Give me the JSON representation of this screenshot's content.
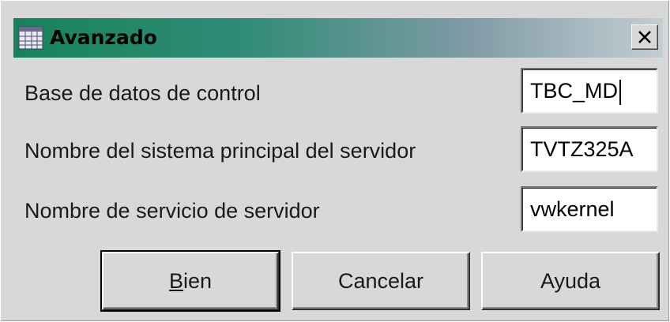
{
  "window": {
    "title": "Avanzado",
    "icon": "table-grid-icon",
    "close_symbol": "close-icon"
  },
  "fields": [
    {
      "label": "Base de datos de control",
      "value": "TBC_MD"
    },
    {
      "label": "Nombre del sistema principal del servidor",
      "value": "TVTZ325A"
    },
    {
      "label": "Nombre de servicio de servidor",
      "value": "vwkernel"
    }
  ],
  "buttons": {
    "ok": {
      "mnemonic": "B",
      "rest": "ien"
    },
    "cancel": "Cancelar",
    "help": "Ayuda"
  },
  "colors": {
    "title_gradient_start": "#17835a",
    "title_gradient_end": "#c3cdd3",
    "dialog_bg": "#d8d8d8"
  }
}
